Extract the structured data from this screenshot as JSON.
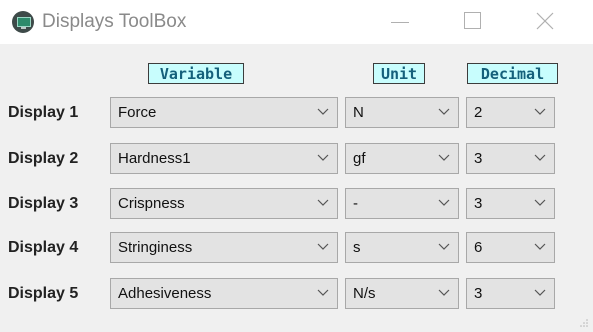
{
  "window": {
    "title": "Displays ToolBox"
  },
  "headers": {
    "variable": "Variable",
    "unit": "Unit",
    "decimal": "Decimal"
  },
  "rows": [
    {
      "label": "Display 1",
      "variable": "Force",
      "unit": "N",
      "decimal": "2"
    },
    {
      "label": "Display 2",
      "variable": "Hardness1",
      "unit": "gf",
      "decimal": "3"
    },
    {
      "label": "Display 3",
      "variable": "Crispness",
      "unit": "-",
      "decimal": "3"
    },
    {
      "label": "Display 4",
      "variable": "Stringiness",
      "unit": "s",
      "decimal": "6"
    },
    {
      "label": "Display 5",
      "variable": "Adhesiveness",
      "unit": "N/s",
      "decimal": "3"
    }
  ],
  "colors": {
    "header_bg": "#c8fdfd",
    "header_text": "#15607b",
    "combo_bg": "#e3e3e3",
    "window_bg": "#f0f0f0"
  },
  "icons": {
    "app": "monitor-app-icon",
    "minimize": "minimize-icon",
    "maximize": "maximize-icon",
    "close": "close-icon",
    "dropdown": "chevron-down-icon"
  }
}
